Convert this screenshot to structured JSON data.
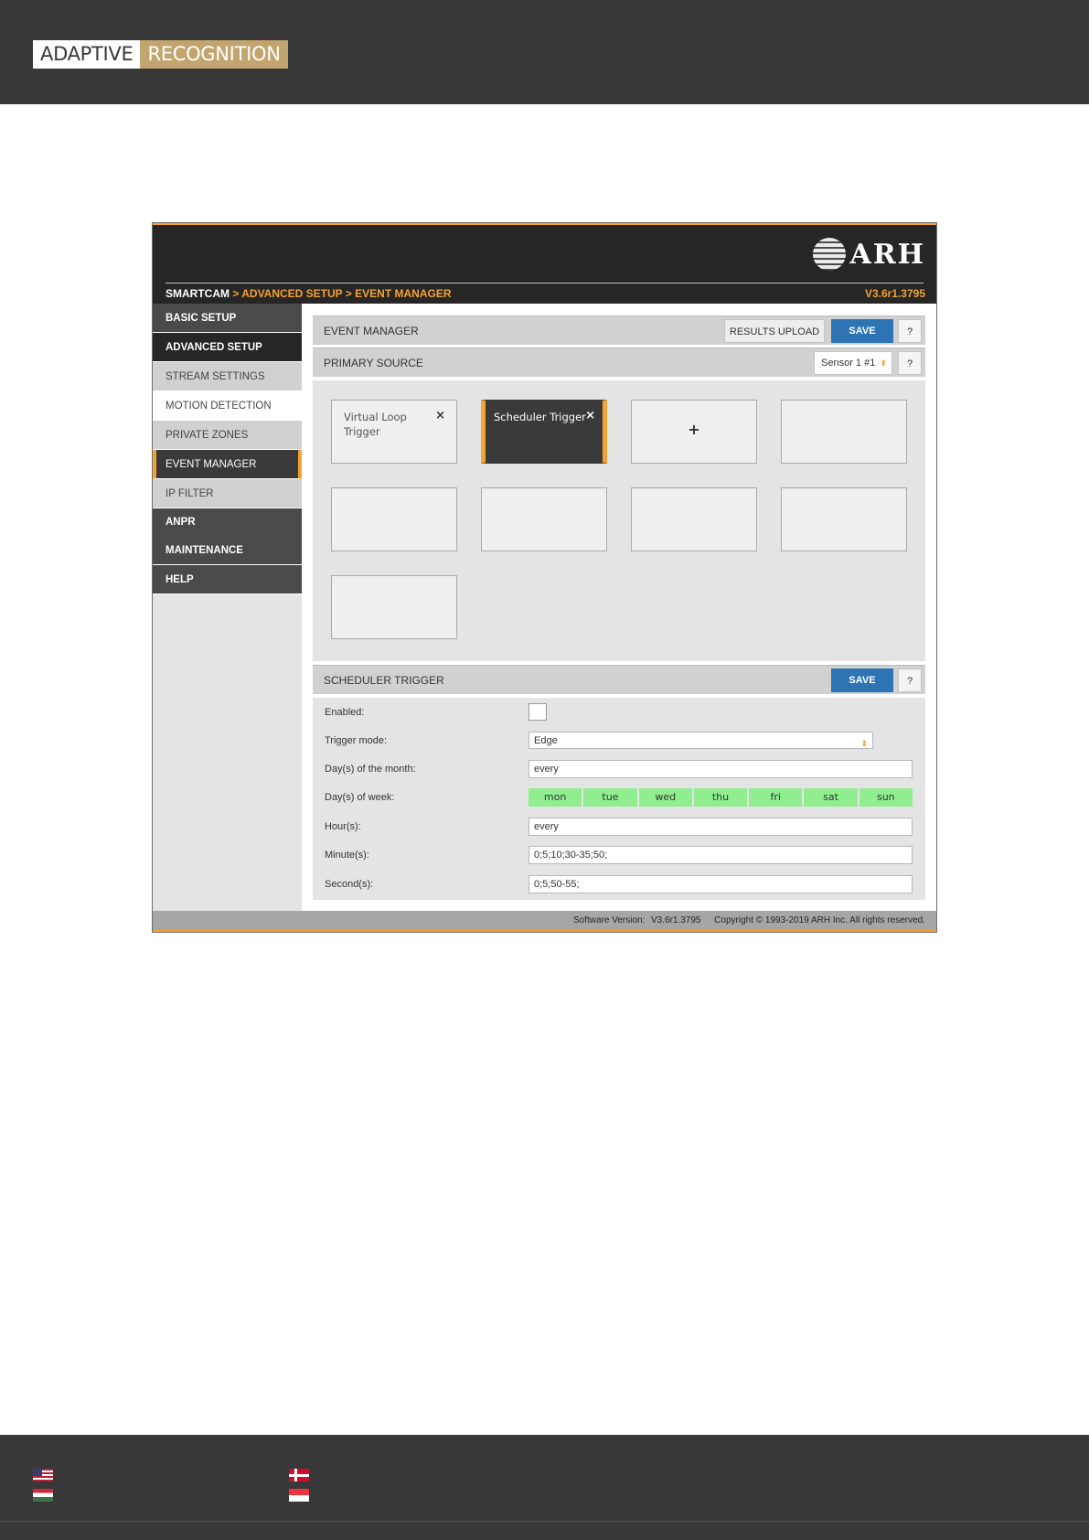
{
  "document": {
    "logo": {
      "part1": "ADAPTIVE",
      "part2": "RECOGNITION"
    }
  },
  "app": {
    "brand": "ARH",
    "breadcrumb": {
      "root": "SMARTCAM",
      "path": " > ADVANCED SETUP > EVENT MANAGER"
    },
    "version": "V3.6r1.3795",
    "sidebar": {
      "items": [
        {
          "label": "BASIC SETUP"
        },
        {
          "label": "ADVANCED SETUP"
        },
        {
          "label": "STREAM SETTINGS"
        },
        {
          "label": "MOTION DETECTION"
        },
        {
          "label": "PRIVATE ZONES"
        },
        {
          "label": "EVENT MANAGER"
        },
        {
          "label": "IP FILTER"
        },
        {
          "label": "ANPR"
        },
        {
          "label": "MAINTENANCE"
        },
        {
          "label": "HELP"
        }
      ]
    },
    "event_manager": {
      "title": "EVENT MANAGER",
      "results_upload": "RESULTS UPLOAD",
      "save": "SAVE",
      "help": "?"
    },
    "primary_source": {
      "title": "PRIMARY SOURCE",
      "sensor_value": "Sensor 1 #1",
      "help": "?"
    },
    "tiles": [
      {
        "label": "Virtual Loop Trigger",
        "close": "×"
      },
      {
        "label": "Scheduler Trigger",
        "close": "×"
      },
      {
        "label": "+"
      }
    ],
    "scheduler": {
      "title": "SCHEDULER TRIGGER",
      "save": "SAVE",
      "help": "?",
      "enabled_label": "Enabled:",
      "enabled": false,
      "trigger_mode_label": "Trigger mode:",
      "trigger_mode": "Edge",
      "days_month_label": "Day(s) of the month:",
      "days_month": "every",
      "days_week_label": "Day(s) of week:",
      "days_week": [
        "mon",
        "tue",
        "wed",
        "thu",
        "fri",
        "sat",
        "sun"
      ],
      "hours_label": "Hour(s):",
      "hours": "every",
      "minutes_label": "Minute(s):",
      "minutes": "0;5;10;30-35;50;",
      "seconds_label": "Second(s):",
      "seconds": "0;5;50-55;"
    },
    "footer": {
      "software_version_label": "Software Version:",
      "software_version": "V3.6r1.3795",
      "copyright": "Copyright © 1993-2019 ARH Inc. All rights reserved."
    }
  },
  "colors": {
    "accent": "#f4a232",
    "primary_button": "#2e74b5",
    "day_active": "#90ee90",
    "header_dark": "#383838"
  }
}
